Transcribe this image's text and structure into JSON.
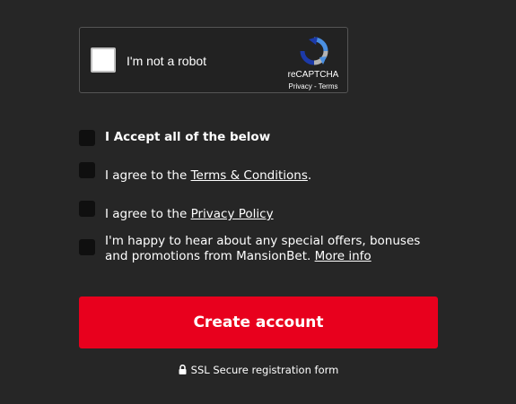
{
  "recaptcha": {
    "label": "I'm not a robot",
    "brand": "reCAPTCHA",
    "privacy_link": "Privacy",
    "separator": " - ",
    "terms_link": "Terms",
    "logo_icon": "recaptcha-logo-icon"
  },
  "consents": {
    "accept_all": "I Accept all of the below",
    "terms_prefix": "I agree to the ",
    "terms_link": "Terms & Conditions",
    "terms_suffix": ".",
    "privacy_prefix": "I agree to the ",
    "privacy_link": "Privacy Policy",
    "marketing_text": "I'm happy to hear about any special offers, bonuses and promotions from MansionBet. ",
    "marketing_link": "More info"
  },
  "actions": {
    "create_account": "Create account"
  },
  "footer": {
    "ssl_text": "SSL Secure registration form",
    "lock_icon": "lock-icon"
  },
  "colors": {
    "background": "#262626",
    "accent": "#e8001d",
    "checkbox_bg": "#0f0f0f",
    "recaptcha_blue": "#4a90e2"
  }
}
